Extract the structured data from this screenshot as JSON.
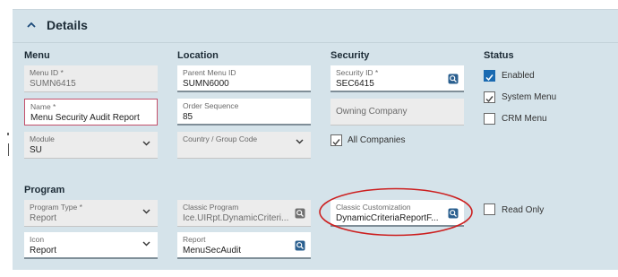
{
  "panel": {
    "title": "Details"
  },
  "sections": {
    "menu": "Menu",
    "location": "Location",
    "security": "Security",
    "status": "Status",
    "program": "Program"
  },
  "menu": {
    "menu_id": {
      "label": "Menu ID *",
      "value": "SUMN6415"
    },
    "name": {
      "label": "Name *",
      "value": "Menu Security Audit Report"
    },
    "module": {
      "label": "Module",
      "value": "SU"
    }
  },
  "location": {
    "parent_menu_id": {
      "label": "Parent Menu ID",
      "value": "SUMN6000"
    },
    "order_sequence": {
      "label": "Order Sequence",
      "value": "85"
    },
    "country_group_code": {
      "label": "Country / Group Code",
      "value": ""
    }
  },
  "security": {
    "security_id": {
      "label": "Security ID *",
      "value": "SEC6415"
    },
    "owning_company": {
      "placeholder": "Owning Company"
    },
    "all_companies": {
      "label": "All Companies",
      "checked": true
    }
  },
  "status": {
    "enabled": {
      "label": "Enabled",
      "checked": true
    },
    "system_menu": {
      "label": "System Menu",
      "checked": true
    },
    "crm_menu": {
      "label": "CRM Menu",
      "checked": false
    }
  },
  "program": {
    "program_type": {
      "label": "Program Type *",
      "value": "Report"
    },
    "icon": {
      "label": "Icon",
      "value": "Report"
    },
    "classic_program": {
      "label": "Classic Program",
      "value": "Ice.UIRpt.DynamicCriteri..."
    },
    "report": {
      "label": "Report",
      "value": "MenuSecAudit"
    },
    "classic_customization": {
      "label": "Classic Customization",
      "value": "DynamicCriteriaReportF..."
    },
    "read_only": {
      "label": "Read Only",
      "checked": false
    }
  },
  "colors": {
    "panel_bg": "#d5e3ea",
    "accent": "#1a6ab1",
    "required_border": "#c4506b",
    "annotation": "#cc1f1f"
  },
  "icons": {
    "collapse": "chevron-up-icon",
    "dropdown": "chevron-down-icon",
    "search": "search-icon",
    "checkmark": "checkmark-icon"
  }
}
